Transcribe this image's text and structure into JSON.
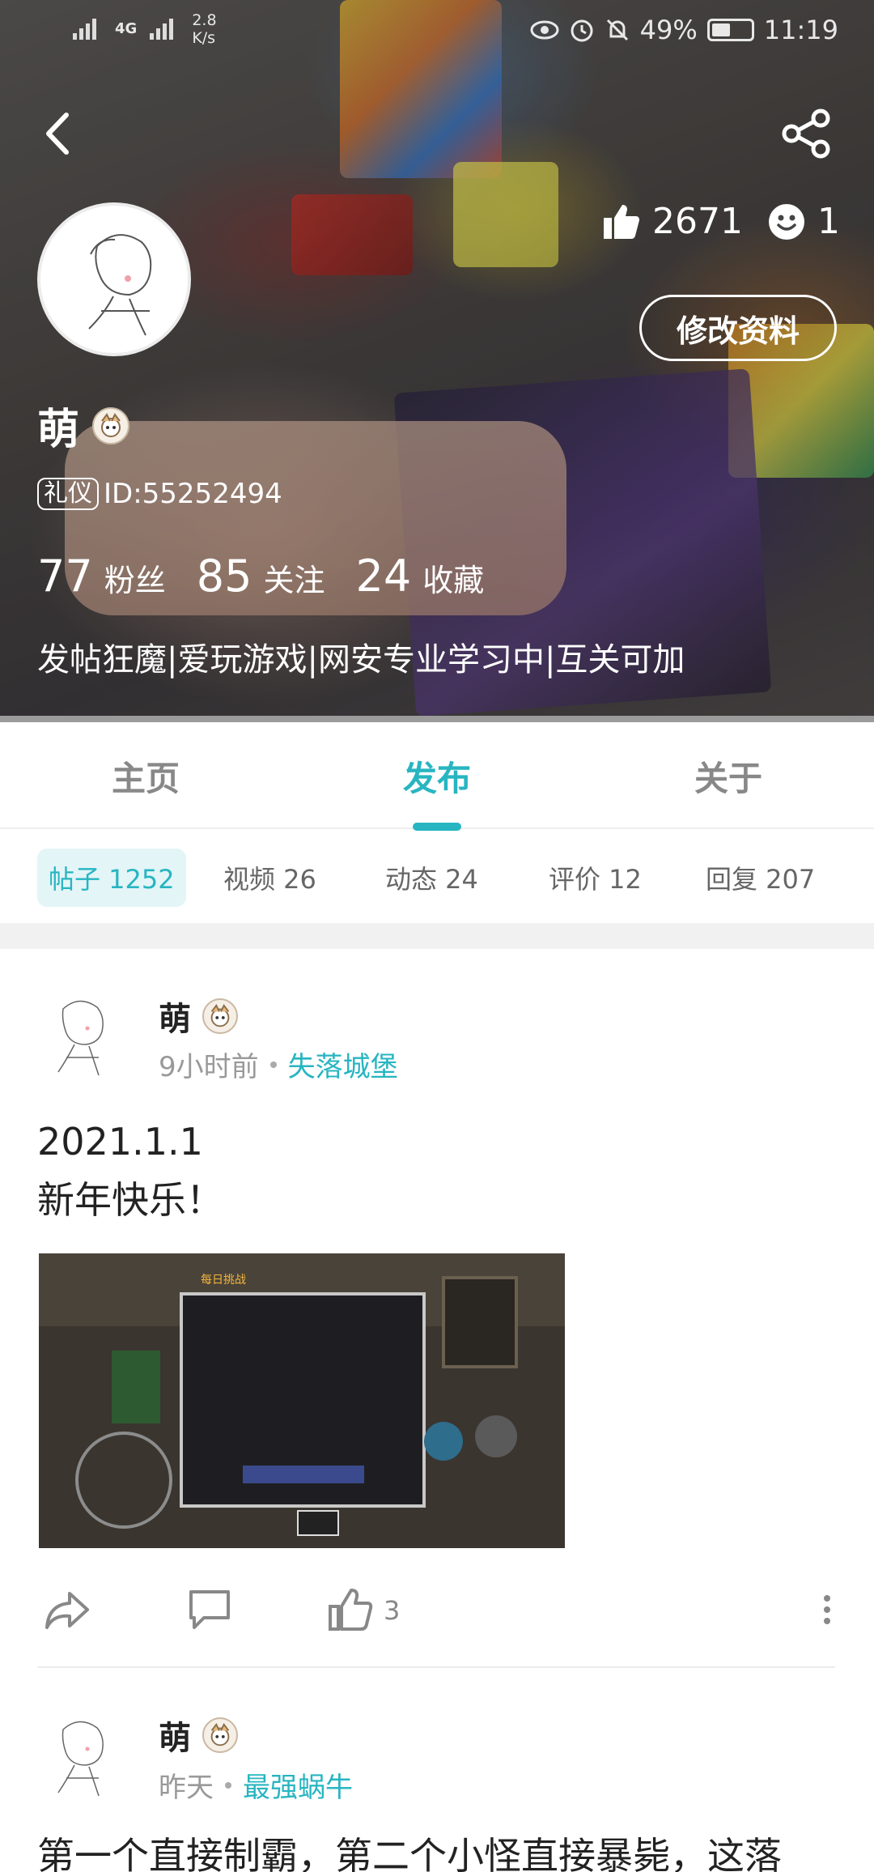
{
  "status_bar": {
    "signal": "4G",
    "speed_value": "2.8",
    "speed_unit": "K/s",
    "battery": "49%",
    "time": "11:19"
  },
  "header": {
    "back_icon": "chevron-left-icon",
    "share_icon": "share-icon"
  },
  "profile": {
    "likes": "2671",
    "fans_emoji_count": "1",
    "edit_label": "修改资料",
    "name": "萌",
    "id_tag": "礼仪",
    "id_text": "ID:55252494",
    "counts": [
      {
        "num": "77",
        "label": "粉丝"
      },
      {
        "num": "85",
        "label": "关注"
      },
      {
        "num": "24",
        "label": "收藏"
      }
    ],
    "bio": "发帖狂魔|爱玩游戏|网安专业学习中|互关可加"
  },
  "tabs": {
    "home": "主页",
    "publish": "发布",
    "about": "关于"
  },
  "subtabs": {
    "posts": "帖子 1252",
    "videos": "视频 26",
    "moments": "动态 24",
    "reviews": "评价 12",
    "replies": "回复 207"
  },
  "posts": [
    {
      "author": "萌",
      "time": "9小时前",
      "group": "失落城堡",
      "line1": "2021.1.1",
      "line2": "新年快乐！",
      "image_caption": "每日挑战",
      "likes": "3"
    },
    {
      "author": "萌",
      "time": "昨天",
      "group": "最强蜗牛",
      "line1": "第一个直接制霸，第二个小怪直接暴毙，这落"
    }
  ],
  "colors": {
    "accent": "#27b5c1",
    "muted": "#999999"
  }
}
